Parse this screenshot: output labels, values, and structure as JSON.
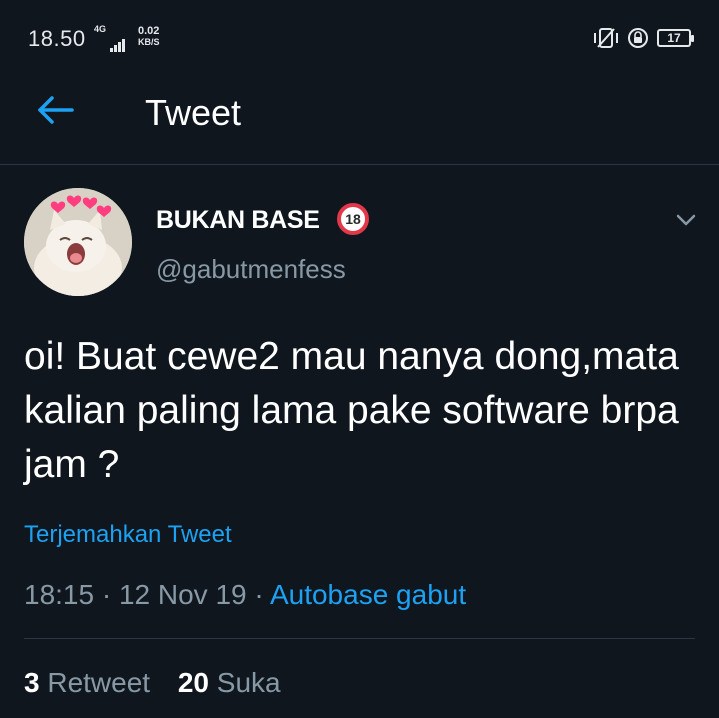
{
  "status_bar": {
    "time": "18.50",
    "network": "4G",
    "speed_value": "0.02",
    "speed_unit": "KB/S",
    "battery": "17",
    "icons": [
      "signal-bars-icon",
      "vibrate-icon",
      "alarm-icon",
      "battery-icon"
    ]
  },
  "header": {
    "back_icon": "back-arrow-icon",
    "title": "Tweet"
  },
  "tweet": {
    "display_name": "BUKAN BASE",
    "badge": "18",
    "handle": "@gabutmenfess",
    "text": "oi! Buat cewe2 mau nanya dong,mata kalian paling lama pake software brpa jam ?",
    "translate_label": "Terjemahkan Tweet",
    "time": "18:15",
    "separator": "·",
    "date": "12 Nov 19",
    "source": "Autobase gabut",
    "retweet_count": "3",
    "retweet_label": "Retweet",
    "like_count": "20",
    "like_label": "Suka"
  },
  "colors": {
    "background": "#0f161e",
    "accent": "#1da1f2",
    "secondary_text": "#8899a6",
    "divider": "#2c3640",
    "badge_ring": "#e2384a"
  }
}
